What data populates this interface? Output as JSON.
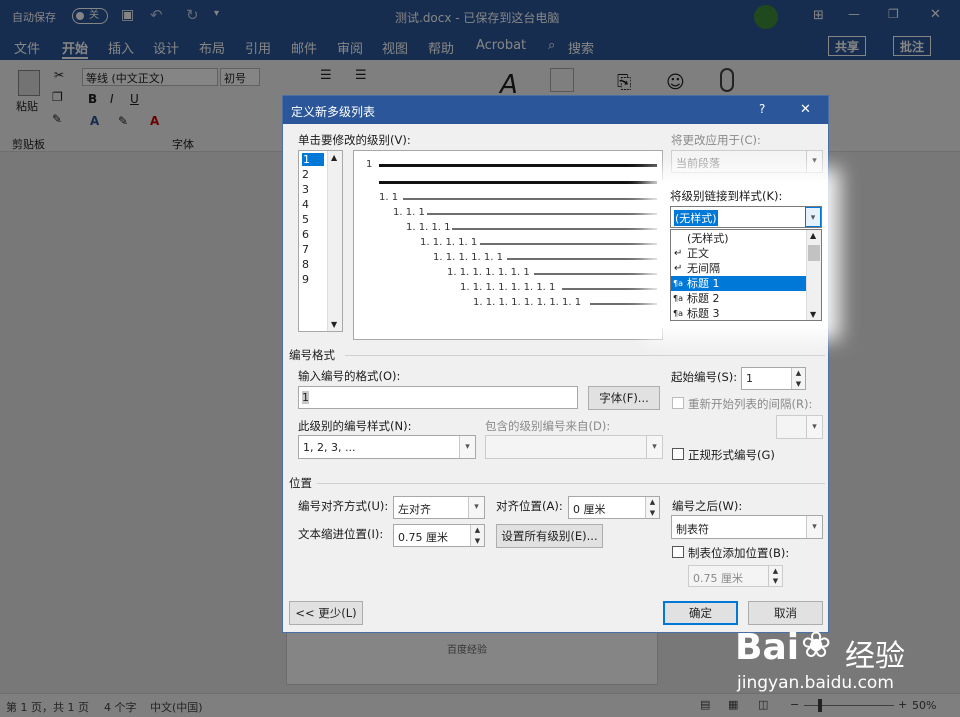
{
  "titlebar": {
    "autosave_label": "自动保存",
    "autosave_state": "关",
    "doc_title": "测试.docx - 已保存到这台电脑",
    "win_min": "—",
    "win_restore": "❐",
    "win_close": "✕"
  },
  "tabs": [
    "文件",
    "开始",
    "插入",
    "设计",
    "布局",
    "引用",
    "邮件",
    "审阅",
    "视图",
    "帮助",
    "Acrobat",
    "搜索"
  ],
  "tab_right": {
    "share": "共享",
    "comment": "批注"
  },
  "ribbon": {
    "paste": "粘贴",
    "clipboard": "剪贴板",
    "font_name": "等线 (中文正文)",
    "font_size": "初号",
    "font_group": "字体"
  },
  "dialog": {
    "title": "定义新多级列表",
    "help": "?",
    "close": "✕",
    "level_label": "单击要修改的级别(V):",
    "levels": [
      "1",
      "2",
      "3",
      "4",
      "5",
      "6",
      "7",
      "8",
      "9"
    ],
    "preview_nums": [
      "1",
      "1. 1",
      "1. 1. 1",
      "1. 1. 1. 1",
      "1. 1. 1. 1. 1",
      "1. 1. 1. 1. 1. 1",
      "1. 1. 1. 1. 1. 1. 1",
      "1. 1. 1. 1. 1. 1. 1. 1",
      "1. 1. 1. 1. 1. 1. 1. 1. 1"
    ],
    "apply_to_label": "将更改应用于(C):",
    "apply_to_value": "当前段落",
    "link_style_label": "将级别链接到样式(K):",
    "link_style_value": "(无样式)",
    "style_options": [
      "(无样式)",
      "正文",
      "无间隔",
      "标题 1",
      "标题 2",
      "标题 3"
    ],
    "number_format_section": "编号格式",
    "enter_format_label": "输入编号的格式(O):",
    "enter_format_value": "1",
    "font_button": "字体(F)...",
    "number_style_label": "此级别的编号样式(N):",
    "number_style_value": "1, 2, 3, ...",
    "include_level_label": "包含的级别编号来自(D):",
    "start_at_label": "起始编号(S):",
    "start_at_value": "1",
    "restart_label": "重新开始列表的间隔(R):",
    "legal_label": "正规形式编号(G)",
    "position_section": "位置",
    "align_label": "编号对齐方式(U):",
    "align_value": "左对齐",
    "aligned_at_label": "对齐位置(A):",
    "aligned_at_value": "0 厘米",
    "follow_label": "编号之后(W):",
    "follow_value": "制表符",
    "indent_label": "文本缩进位置(I):",
    "indent_value": "0.75 厘米",
    "set_all_button": "设置所有级别(E)...",
    "tab_stop_label": "制表位添加位置(B):",
    "tab_stop_value": "0.75 厘米",
    "less_button": "<< 更少(L)",
    "ok_button": "确定",
    "cancel_button": "取消"
  },
  "page_text": "百度经验",
  "status": {
    "page": "第 1 页，共 1 页",
    "words": "4 个字",
    "lang": "中文(中国)",
    "zoom": "50%"
  },
  "watermark": {
    "brand_left": "Bai",
    "brand_right": "经验",
    "url": "jingyan.baidu.com"
  }
}
